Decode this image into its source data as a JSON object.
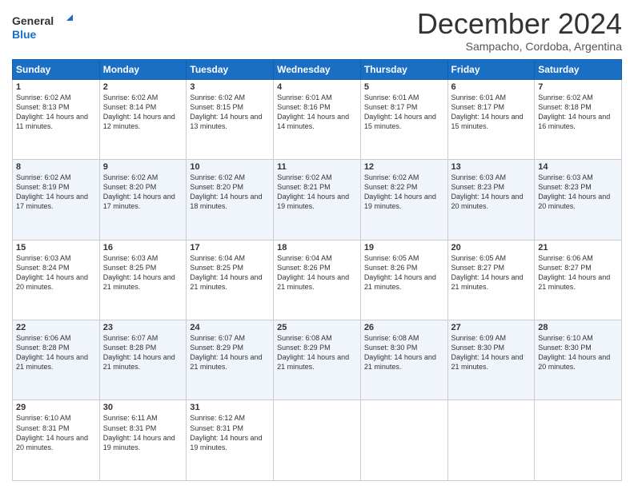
{
  "logo": {
    "general": "General",
    "blue": "Blue"
  },
  "header": {
    "month": "December 2024",
    "location": "Sampacho, Cordoba, Argentina"
  },
  "weekdays": [
    "Sunday",
    "Monday",
    "Tuesday",
    "Wednesday",
    "Thursday",
    "Friday",
    "Saturday"
  ],
  "weeks": [
    [
      {
        "day": "1",
        "sunrise": "6:02 AM",
        "sunset": "8:13 PM",
        "daylight": "14 hours and 11 minutes."
      },
      {
        "day": "2",
        "sunrise": "6:02 AM",
        "sunset": "8:14 PM",
        "daylight": "14 hours and 12 minutes."
      },
      {
        "day": "3",
        "sunrise": "6:02 AM",
        "sunset": "8:15 PM",
        "daylight": "14 hours and 13 minutes."
      },
      {
        "day": "4",
        "sunrise": "6:01 AM",
        "sunset": "8:16 PM",
        "daylight": "14 hours and 14 minutes."
      },
      {
        "day": "5",
        "sunrise": "6:01 AM",
        "sunset": "8:17 PM",
        "daylight": "14 hours and 15 minutes."
      },
      {
        "day": "6",
        "sunrise": "6:01 AM",
        "sunset": "8:17 PM",
        "daylight": "14 hours and 15 minutes."
      },
      {
        "day": "7",
        "sunrise": "6:02 AM",
        "sunset": "8:18 PM",
        "daylight": "14 hours and 16 minutes."
      }
    ],
    [
      {
        "day": "8",
        "sunrise": "6:02 AM",
        "sunset": "8:19 PM",
        "daylight": "14 hours and 17 minutes."
      },
      {
        "day": "9",
        "sunrise": "6:02 AM",
        "sunset": "8:20 PM",
        "daylight": "14 hours and 17 minutes."
      },
      {
        "day": "10",
        "sunrise": "6:02 AM",
        "sunset": "8:20 PM",
        "daylight": "14 hours and 18 minutes."
      },
      {
        "day": "11",
        "sunrise": "6:02 AM",
        "sunset": "8:21 PM",
        "daylight": "14 hours and 19 minutes."
      },
      {
        "day": "12",
        "sunrise": "6:02 AM",
        "sunset": "8:22 PM",
        "daylight": "14 hours and 19 minutes."
      },
      {
        "day": "13",
        "sunrise": "6:03 AM",
        "sunset": "8:23 PM",
        "daylight": "14 hours and 20 minutes."
      },
      {
        "day": "14",
        "sunrise": "6:03 AM",
        "sunset": "8:23 PM",
        "daylight": "14 hours and 20 minutes."
      }
    ],
    [
      {
        "day": "15",
        "sunrise": "6:03 AM",
        "sunset": "8:24 PM",
        "daylight": "14 hours and 20 minutes."
      },
      {
        "day": "16",
        "sunrise": "6:03 AM",
        "sunset": "8:25 PM",
        "daylight": "14 hours and 21 minutes."
      },
      {
        "day": "17",
        "sunrise": "6:04 AM",
        "sunset": "8:25 PM",
        "daylight": "14 hours and 21 minutes."
      },
      {
        "day": "18",
        "sunrise": "6:04 AM",
        "sunset": "8:26 PM",
        "daylight": "14 hours and 21 minutes."
      },
      {
        "day": "19",
        "sunrise": "6:05 AM",
        "sunset": "8:26 PM",
        "daylight": "14 hours and 21 minutes."
      },
      {
        "day": "20",
        "sunrise": "6:05 AM",
        "sunset": "8:27 PM",
        "daylight": "14 hours and 21 minutes."
      },
      {
        "day": "21",
        "sunrise": "6:06 AM",
        "sunset": "8:27 PM",
        "daylight": "14 hours and 21 minutes."
      }
    ],
    [
      {
        "day": "22",
        "sunrise": "6:06 AM",
        "sunset": "8:28 PM",
        "daylight": "14 hours and 21 minutes."
      },
      {
        "day": "23",
        "sunrise": "6:07 AM",
        "sunset": "8:28 PM",
        "daylight": "14 hours and 21 minutes."
      },
      {
        "day": "24",
        "sunrise": "6:07 AM",
        "sunset": "8:29 PM",
        "daylight": "14 hours and 21 minutes."
      },
      {
        "day": "25",
        "sunrise": "6:08 AM",
        "sunset": "8:29 PM",
        "daylight": "14 hours and 21 minutes."
      },
      {
        "day": "26",
        "sunrise": "6:08 AM",
        "sunset": "8:30 PM",
        "daylight": "14 hours and 21 minutes."
      },
      {
        "day": "27",
        "sunrise": "6:09 AM",
        "sunset": "8:30 PM",
        "daylight": "14 hours and 21 minutes."
      },
      {
        "day": "28",
        "sunrise": "6:10 AM",
        "sunset": "8:30 PM",
        "daylight": "14 hours and 20 minutes."
      }
    ],
    [
      {
        "day": "29",
        "sunrise": "6:10 AM",
        "sunset": "8:31 PM",
        "daylight": "14 hours and 20 minutes."
      },
      {
        "day": "30",
        "sunrise": "6:11 AM",
        "sunset": "8:31 PM",
        "daylight": "14 hours and 19 minutes."
      },
      {
        "day": "31",
        "sunrise": "6:12 AM",
        "sunset": "8:31 PM",
        "daylight": "14 hours and 19 minutes."
      },
      null,
      null,
      null,
      null
    ]
  ]
}
